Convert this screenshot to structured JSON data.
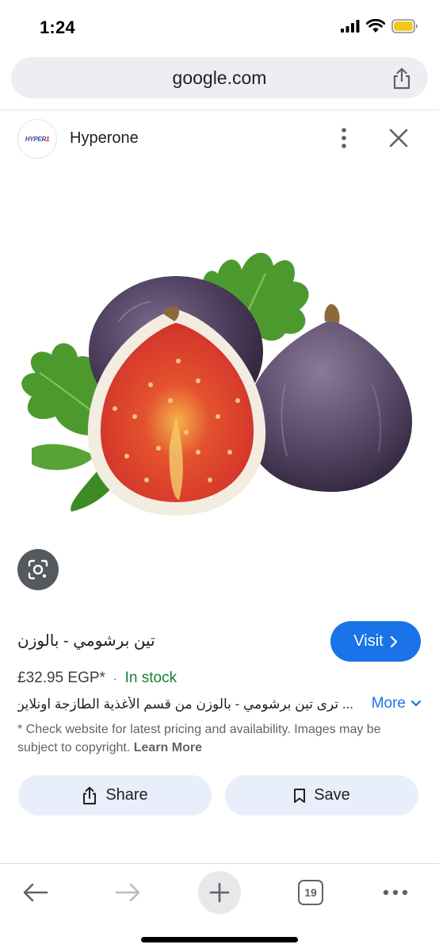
{
  "status_bar": {
    "time": "1:24",
    "icons": [
      "cellular-signal-icon",
      "wifi-icon",
      "battery-icon"
    ],
    "battery_color": "#f5c518"
  },
  "browser": {
    "url": "google.com",
    "share_icon": "share-icon"
  },
  "source": {
    "logo_text_primary": "HYPER",
    "logo_text_accent": "1",
    "name": "Hyperone",
    "menu_icon": "more-vert-icon",
    "close_icon": "close-icon"
  },
  "image": {
    "subject": "figs",
    "lens_icon": "google-lens-icon"
  },
  "product": {
    "title": "تين برشومي - بالوزن",
    "visit_label": "Visit",
    "price": "£32.95 EGP*",
    "separator": "·",
    "stock": "In stock",
    "description": "... ترى تين برشومي - بالوزن من قسم الأغذية الطازجة اونلاين",
    "more_label": "More",
    "disclaimer": "* Check website for latest pricing and availability. Images may be subject to copyright.",
    "learn_more": "Learn More"
  },
  "actions": {
    "share_label": "Share",
    "save_label": "Save"
  },
  "toolbar": {
    "tab_count": "19",
    "items": [
      "back-icon",
      "forward-icon",
      "new-tab-icon",
      "tab-switcher-icon",
      "more-horiz-icon"
    ]
  },
  "colors": {
    "accent": "#1a73e8",
    "in_stock": "#188038",
    "action_bg": "#e8effa",
    "url_bar_bg": "#eceef1"
  }
}
